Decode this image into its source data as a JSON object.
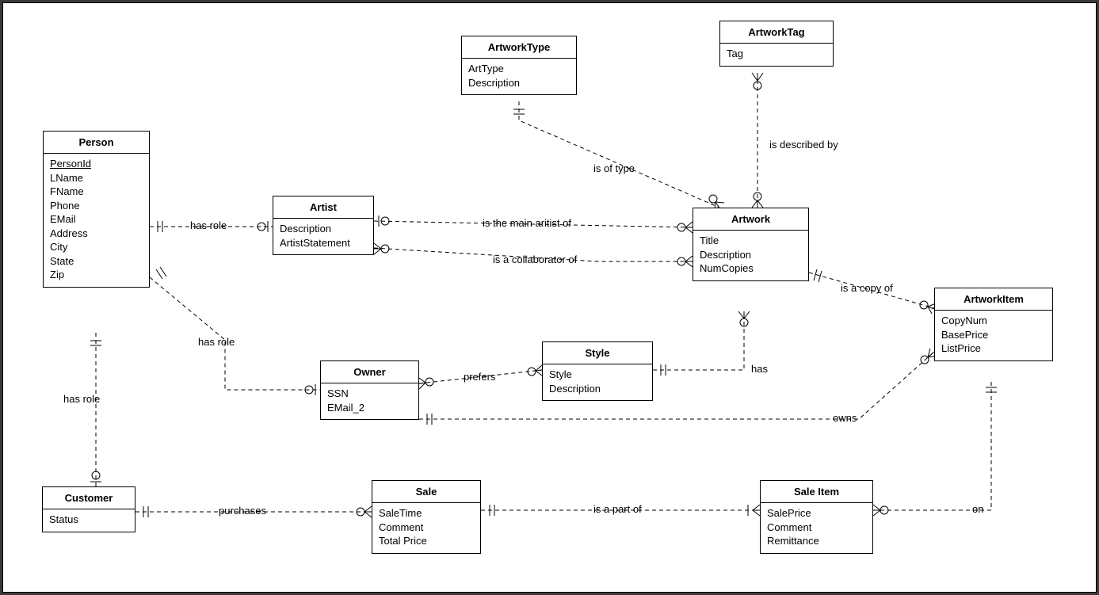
{
  "entities": {
    "person": {
      "title": "Person",
      "attrs": [
        "PersonId",
        "LName",
        "FName",
        "Phone",
        "EMail",
        "Address",
        "City",
        "State",
        "Zip"
      ],
      "pk": [
        "PersonId"
      ]
    },
    "artist": {
      "title": "Artist",
      "attrs": [
        "Description",
        "ArtistStatement"
      ]
    },
    "owner": {
      "title": "Owner",
      "attrs": [
        "SSN",
        "EMail_2"
      ]
    },
    "customer": {
      "title": "Customer",
      "attrs": [
        "Status"
      ]
    },
    "artworkType": {
      "title": "ArtworkType",
      "attrs": [
        "ArtType",
        "Description"
      ]
    },
    "artworkTag": {
      "title": "ArtworkTag",
      "attrs": [
        "Tag"
      ]
    },
    "artwork": {
      "title": "Artwork",
      "attrs": [
        "Title",
        "Description",
        "NumCopies"
      ]
    },
    "style": {
      "title": "Style",
      "attrs": [
        "Style",
        "Description"
      ]
    },
    "artworkItem": {
      "title": "ArtworkItem",
      "attrs": [
        "CopyNum",
        "BasePrice",
        "ListPrice"
      ]
    },
    "sale": {
      "title": "Sale",
      "attrs": [
        "SaleTime",
        "Comment",
        "Total Price"
      ]
    },
    "saleItem": {
      "title": "Sale Item",
      "attrs": [
        "SalePrice",
        "Comment",
        "Remittance"
      ]
    }
  },
  "labels": {
    "hasRole1": "has role",
    "hasRole2": "has role",
    "hasRole3": "has role",
    "isOfType": "is of type",
    "isDescribedBy": "is described by",
    "isMainArtist": "is the main aritist of",
    "isCollaborator": "is a collaborator of",
    "prefers": "prefers",
    "has": "has",
    "isCopyOf": "is a copy of",
    "owns": "owns",
    "purchases": "purchases",
    "isPartOf": "is a part of",
    "on": "on"
  }
}
